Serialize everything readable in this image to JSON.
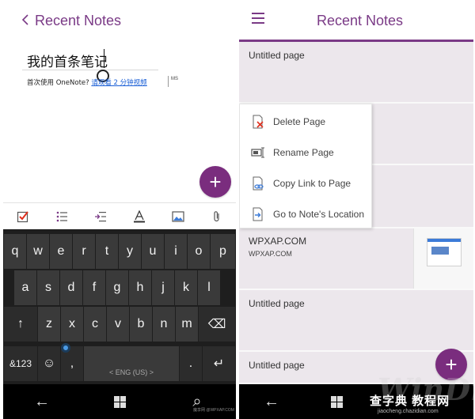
{
  "left": {
    "header": {
      "title": "Recent Notes",
      "back_icon": "chevron-left-icon"
    },
    "note": {
      "title": "我的首条笔记",
      "body_text": "首次使用 OneNote? ",
      "body_link": "请观看 2 分钟视频",
      "side_mark": "MS"
    },
    "fab": {
      "label": "+",
      "icon": "add-icon"
    },
    "toolbar": {
      "items": [
        "checkbox-icon",
        "bulleted-list-icon",
        "indent-icon",
        "font-color-icon",
        "picture-icon",
        "attachment-icon"
      ]
    },
    "keyboard": {
      "row1": [
        "q",
        "w",
        "e",
        "r",
        "t",
        "y",
        "u",
        "i",
        "o",
        "p"
      ],
      "row2": [
        "a",
        "s",
        "d",
        "f",
        "g",
        "h",
        "j",
        "k",
        "l"
      ],
      "row3": [
        "↑",
        "z",
        "x",
        "c",
        "v",
        "b",
        "n",
        "m",
        "⌫"
      ],
      "row4": [
        "&123",
        "☺",
        ",",
        "< ENG (US) >",
        ".",
        "↵"
      ]
    },
    "navbar": {
      "back": "←",
      "search": "⌕"
    },
    "watermark": "魔享网 @WPXAP.COM"
  },
  "right": {
    "header": {
      "title": "Recent Notes",
      "menu_icon": "hamburger-icon"
    },
    "cards": [
      {
        "title": "Untitled page",
        "subtitle": ""
      },
      {
        "title": "",
        "subtitle": ""
      },
      {
        "title": "",
        "subtitle": ""
      },
      {
        "title": "WPXAP.COM",
        "subtitle": "WPXAP.COM"
      },
      {
        "title": "Untitled page",
        "subtitle": ""
      },
      {
        "title": "Untitled page",
        "subtitle": ""
      }
    ],
    "context_menu": [
      {
        "label": "Delete Page",
        "icon": "delete-page-icon"
      },
      {
        "label": "Rename Page",
        "icon": "rename-page-icon"
      },
      {
        "label": "Copy Link to Page",
        "icon": "copy-link-icon"
      },
      {
        "label": "Go to Note's Location",
        "icon": "go-to-location-icon"
      }
    ],
    "fab": {
      "label": "+",
      "icon": "add-icon"
    },
    "navbar": {
      "back": "←"
    },
    "watermark_cn": "查字典 教程网",
    "watermark_url": "jiaocheng.chazidian.com",
    "ghost_watermark": "WinDrivers"
  },
  "colors": {
    "accent": "#7a2d7e",
    "header_text": "#7a3a86",
    "card_bg": "#ece7ec"
  }
}
